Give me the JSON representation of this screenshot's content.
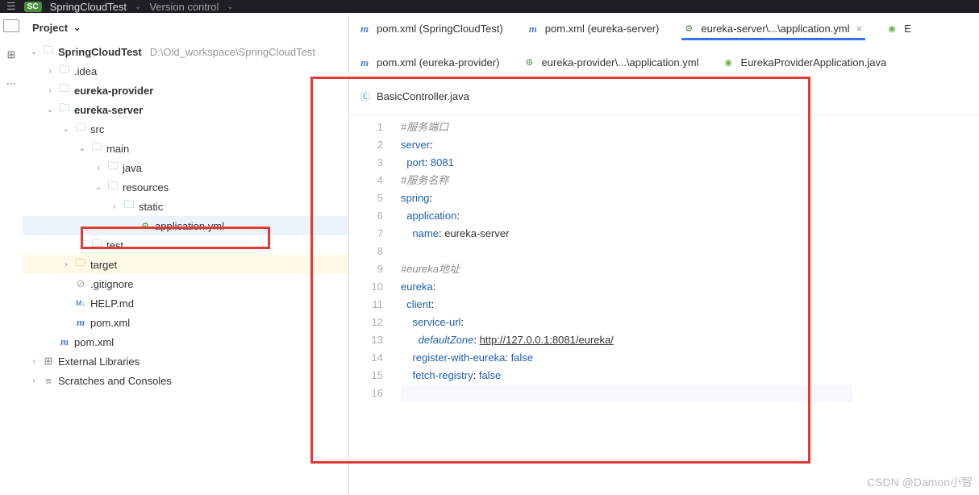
{
  "topbar": {
    "hamburger": "☰",
    "badge": "SC",
    "project": "SpringCloudTest",
    "vc": "Version control"
  },
  "projpanel": {
    "title": "Project"
  },
  "tree": {
    "root": {
      "name": "SpringCloudTest",
      "path": "D:\\Old_workspace\\SpringCloudTest"
    },
    "idea": ".idea",
    "provider": "eureka-provider",
    "server": "eureka-server",
    "src": "src",
    "main": "main",
    "java": "java",
    "resources": "resources",
    "static": "static",
    "appyml": "application.yml",
    "test": "test",
    "target": "target",
    "gitignore": ".gitignore",
    "help": "HELP.md",
    "pom1": "pom.xml",
    "pom2": "pom.xml",
    "ext": "External Libraries",
    "scratch": "Scratches and Consoles"
  },
  "tabs": {
    "row1": [
      {
        "icon": "maven",
        "label": "pom.xml (SpringCloudTest)"
      },
      {
        "icon": "maven",
        "label": "pom.xml (eureka-server)"
      },
      {
        "icon": "yml",
        "label": "eureka-server\\...\\application.yml",
        "active": true,
        "close": true
      },
      {
        "icon": "spring",
        "label": "E",
        "cut": true
      }
    ],
    "row2": [
      {
        "icon": "maven",
        "label": "pom.xml (eureka-provider)"
      },
      {
        "icon": "yml",
        "label": "eureka-provider\\...\\application.yml"
      },
      {
        "icon": "spring",
        "label": "EurekaProviderApplication.java"
      }
    ],
    "row3": [
      {
        "icon": "java",
        "label": "BasicController.java"
      }
    ]
  },
  "code": {
    "lines": [
      [
        {
          "c": "cc-comment",
          "t": "#服务端口"
        }
      ],
      [
        {
          "c": "cc-key",
          "t": "server"
        },
        {
          "c": "",
          "t": ":"
        }
      ],
      [
        {
          "c": "",
          "t": "  "
        },
        {
          "c": "cc-key",
          "t": "port"
        },
        {
          "c": "",
          "t": ": "
        },
        {
          "c": "cc-key",
          "t": "8081"
        }
      ],
      [
        {
          "c": "cc-comment",
          "t": "#服务名称"
        }
      ],
      [
        {
          "c": "cc-key",
          "t": "spring"
        },
        {
          "c": "",
          "t": ":"
        }
      ],
      [
        {
          "c": "",
          "t": "  "
        },
        {
          "c": "cc-key",
          "t": "application"
        },
        {
          "c": "",
          "t": ":"
        }
      ],
      [
        {
          "c": "",
          "t": "    "
        },
        {
          "c": "cc-key",
          "t": "name"
        },
        {
          "c": "",
          "t": ": "
        },
        {
          "c": "cc-val",
          "t": "eureka-server"
        }
      ],
      [],
      [
        {
          "c": "cc-comment",
          "t": "#eureka地址"
        }
      ],
      [
        {
          "c": "cc-key",
          "t": "eureka"
        },
        {
          "c": "",
          "t": ":"
        }
      ],
      [
        {
          "c": "",
          "t": "  "
        },
        {
          "c": "cc-key",
          "t": "client"
        },
        {
          "c": "",
          "t": ":"
        }
      ],
      [
        {
          "c": "",
          "t": "    "
        },
        {
          "c": "cc-key",
          "t": "service-url"
        },
        {
          "c": "",
          "t": ":"
        }
      ],
      [
        {
          "c": "",
          "t": "      "
        },
        {
          "c": "cc-italic",
          "t": "defaultZone"
        },
        {
          "c": "",
          "t": ": "
        },
        {
          "c": "cc-link",
          "t": "http://127.0.0.1:8081/eureka/"
        }
      ],
      [
        {
          "c": "",
          "t": "    "
        },
        {
          "c": "cc-key",
          "t": "register-with-eureka"
        },
        {
          "c": "",
          "t": ": "
        },
        {
          "c": "cc-key",
          "t": "false"
        }
      ],
      [
        {
          "c": "",
          "t": "    "
        },
        {
          "c": "cc-key",
          "t": "fetch-registry"
        },
        {
          "c": "",
          "t": ": "
        },
        {
          "c": "cc-key",
          "t": "false"
        }
      ],
      []
    ]
  },
  "watermark": "CSDN @Damon小智"
}
